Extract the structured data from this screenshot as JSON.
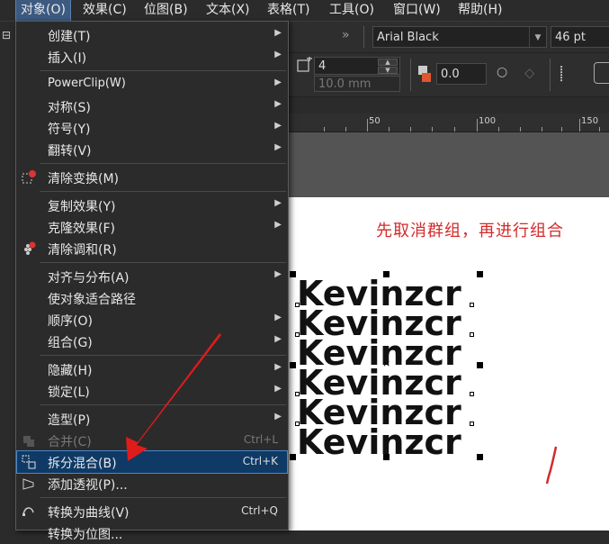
{
  "menubar": {
    "items": [
      {
        "label": "对象(O)",
        "active": true
      },
      {
        "label": "效果(C)"
      },
      {
        "label": "位图(B)"
      },
      {
        "label": "文本(X)"
      },
      {
        "label": "表格(T)"
      },
      {
        "label": "工具(O)"
      },
      {
        "label": "窗口(W)"
      },
      {
        "label": "帮助(H)"
      }
    ]
  },
  "toolbar": {
    "font_name": "Arial Black",
    "font_size": "46 pt",
    "steps_value": "4",
    "offset_value": "10.0 mm",
    "opacity_value": "0.0"
  },
  "ruler": {
    "labels": [
      "50",
      "100",
      "150"
    ]
  },
  "canvas": {
    "note": "先取消群组，再进行组合",
    "text_lines": [
      "Kevinzcr",
      "Kevinzcr",
      "Kevinzcr",
      "Kevinzcr",
      "Kevinzcr",
      "Kevinzcr"
    ]
  },
  "menu": {
    "items": [
      {
        "label": "创建(T)",
        "submenu": true
      },
      {
        "label": "插入(I)",
        "submenu": true
      },
      {
        "label": "PowerClip(W)",
        "submenu": true
      },
      {
        "label": "对称(S)",
        "submenu": true
      },
      {
        "label": "符号(Y)",
        "submenu": true
      },
      {
        "label": "翻转(V)",
        "submenu": true
      },
      {
        "label": "清除变换(M)",
        "icon": "clear-transform-icon"
      },
      {
        "label": "复制效果(Y)",
        "submenu": true
      },
      {
        "label": "克隆效果(F)",
        "submenu": true
      },
      {
        "label": "清除调和(R)",
        "icon": "clear-blend-icon"
      },
      {
        "label": "对齐与分布(A)",
        "submenu": true
      },
      {
        "label": "使对象适合路径"
      },
      {
        "label": "顺序(O)",
        "submenu": true
      },
      {
        "label": "组合(G)",
        "submenu": true
      },
      {
        "label": "隐藏(H)",
        "submenu": true
      },
      {
        "label": "锁定(L)",
        "submenu": true
      },
      {
        "label": "造型(P)",
        "submenu": true
      },
      {
        "label": "合并(C)",
        "shortcut": "Ctrl+L",
        "disabled": true,
        "icon": "combine-icon"
      },
      {
        "label": "拆分混合(B)",
        "shortcut": "Ctrl+K",
        "highlight": true,
        "icon": "break-apart-icon"
      },
      {
        "label": "添加透视(P)...",
        "icon": "perspective-icon"
      },
      {
        "label": "转换为曲线(V)",
        "shortcut": "Ctrl+Q",
        "icon": "convert-curves-icon"
      },
      {
        "label": "转换为位图..."
      }
    ]
  },
  "colors": {
    "accent": "#0f3a66",
    "annotation_red": "#d42a2a",
    "menu_bg": "#2b2b2b"
  }
}
